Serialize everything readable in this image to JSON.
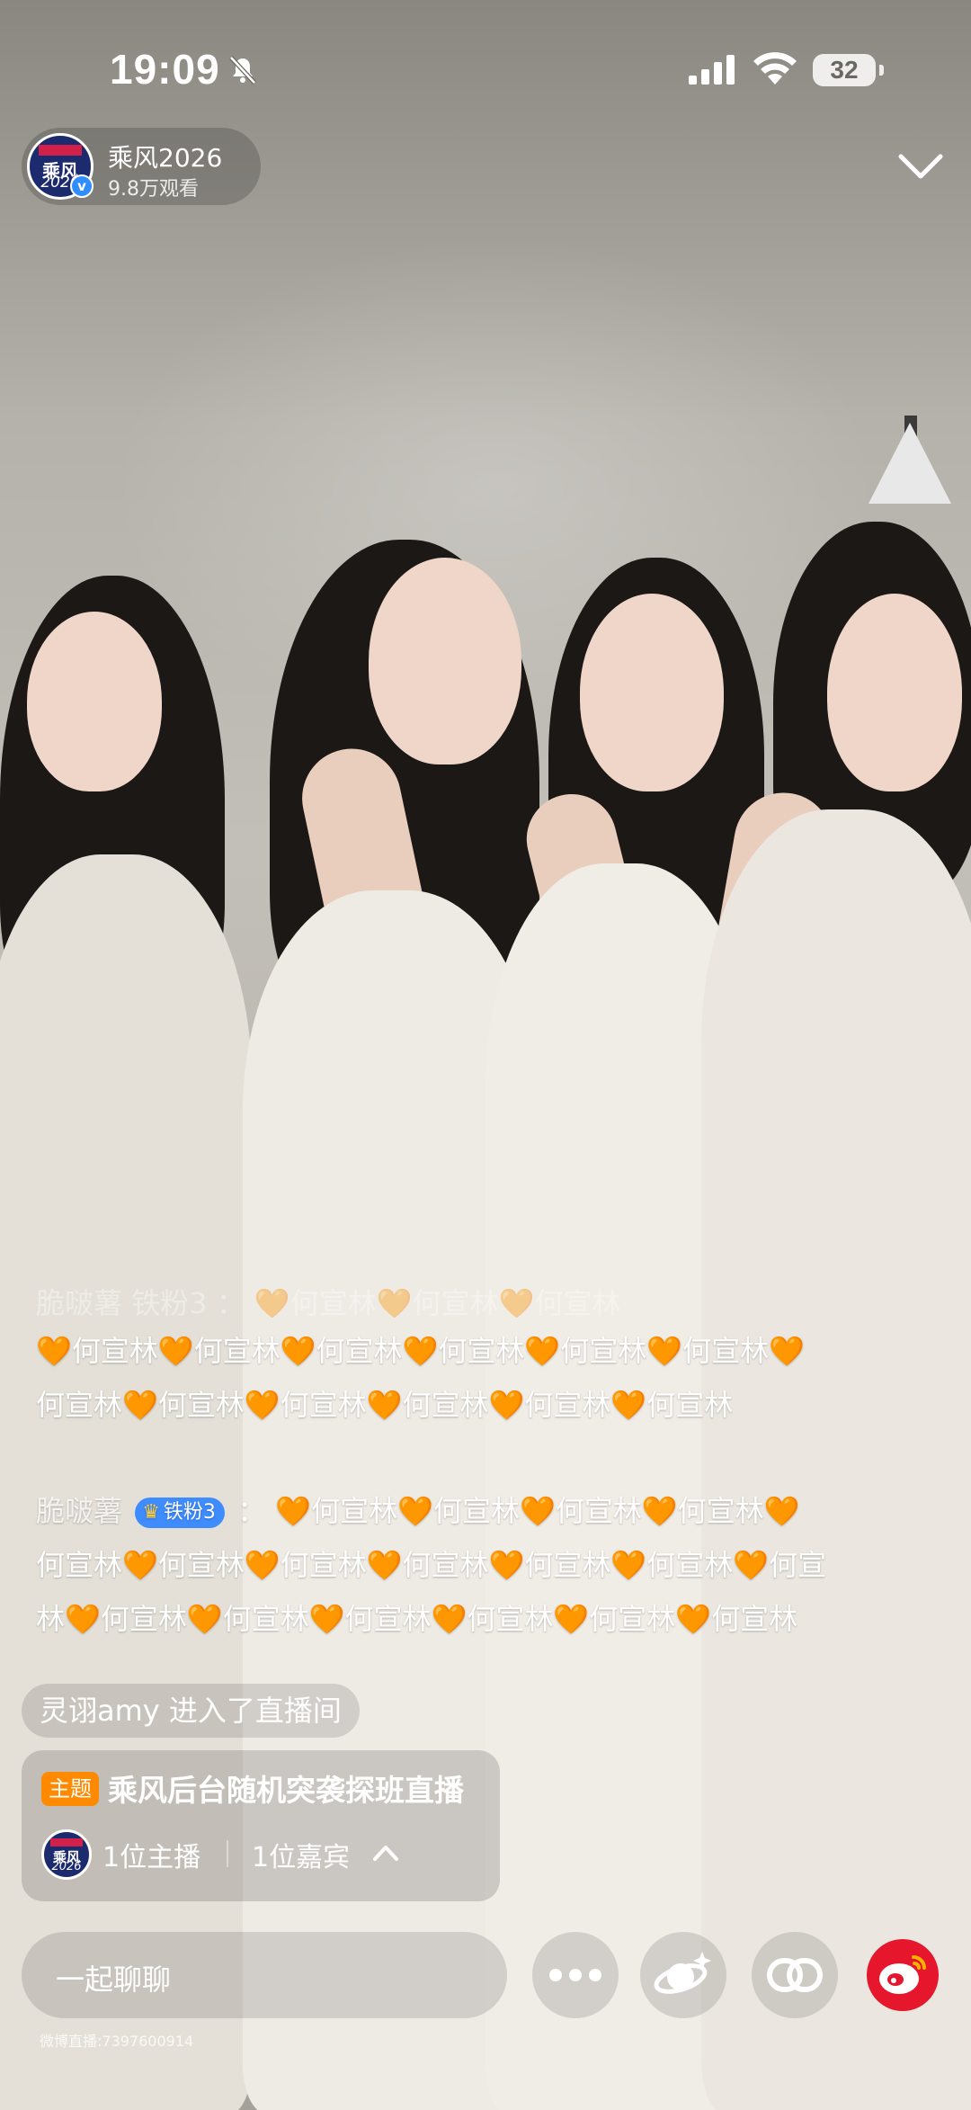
{
  "status_bar": {
    "time": "19:09",
    "battery_level": "32"
  },
  "host": {
    "logo_text_top": "乘风",
    "logo_text_bottom": "2026",
    "name": "乘风2026",
    "viewers": "9.8万观看"
  },
  "chat": {
    "faded_line": "脆啵薯  铁粉3 ： 🧡何宣林🧡何宣林🧡何宣林",
    "messages": [
      {
        "nick": "",
        "badge": "",
        "text": "🧡何宣林🧡何宣林🧡何宣林🧡何宣林🧡何宣林🧡何宣林🧡何宣林🧡何宣林🧡何宣林🧡何宣林🧡何宣林🧡何宣林"
      },
      {
        "nick": "脆啵薯",
        "badge": "铁粉3",
        "separator": "：",
        "text": "🧡何宣林🧡何宣林🧡何宣林🧡何宣林🧡何宣林🧡何宣林🧡何宣林🧡何宣林🧡何宣林🧡何宣林🧡何宣林🧡何宣林🧡何宣林🧡何宣林🧡何宣林🧡何宣林🧡何宣林"
      }
    ],
    "join_notice": "灵诩amy 进入了直播间"
  },
  "topic": {
    "tag": "主题",
    "title": "乘风后台随机突袭探班直播",
    "host_count": "1位主播",
    "guest_count": "1位嘉宾"
  },
  "bottom_bar": {
    "input_placeholder": "一起聊聊",
    "room_id": "微博直播:7397600914",
    "icons": [
      "more-dots-icon",
      "gift-planet-icon",
      "share-link-icon",
      "weibo-logo-icon"
    ]
  },
  "colors": {
    "accent_orange": "#ff8a00",
    "fan_badge_blue": "#3f8cff",
    "verified_blue": "#2f8dff",
    "weibo_red": "#e6162d"
  }
}
